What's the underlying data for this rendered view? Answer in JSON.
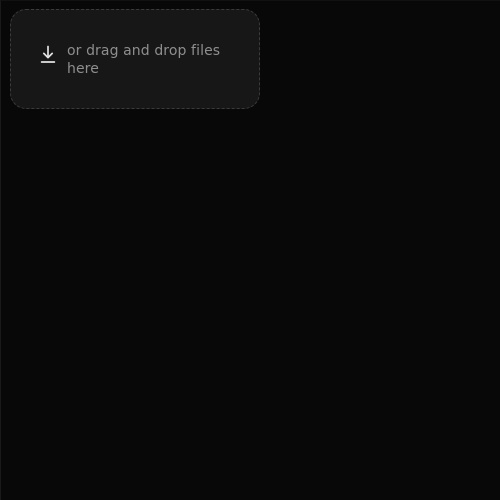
{
  "dropzone": {
    "label": "or drag and drop files here",
    "icon": "download-icon"
  },
  "colors": {
    "background": "#080808",
    "panel": "#171717",
    "border": "#3b3b3b",
    "text": "#8e8e8e",
    "icon": "#e3e3e3"
  }
}
